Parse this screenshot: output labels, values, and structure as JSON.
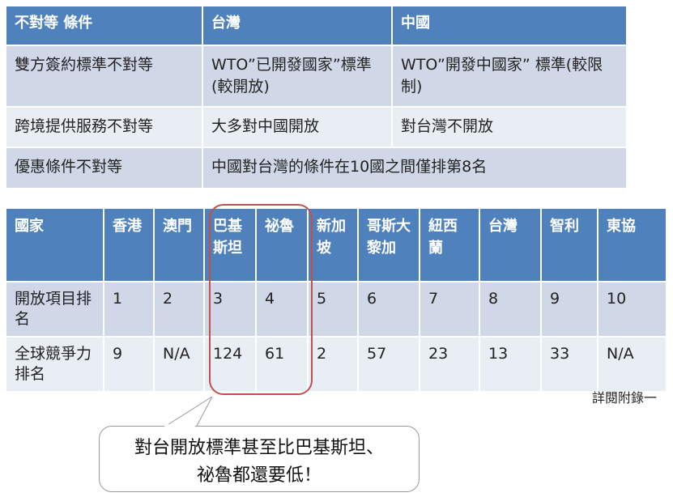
{
  "table1": {
    "headers": [
      "不對等 條件",
      "台灣",
      "中國"
    ],
    "rows": [
      [
        "雙方簽約標準不對等",
        "WTO”已開發國家”標準(較開放)",
        "WTO”開發中國家” 標準(較限制)"
      ],
      [
        "跨境提供服務不對等",
        "大多對中國開放",
        "對台灣不開放"
      ],
      [
        "優惠條件不對等",
        "中國對台灣的條件在10國之間僅排第8名"
      ]
    ]
  },
  "table2": {
    "headers": [
      "國家",
      "香港",
      "澳門",
      "巴基斯坦",
      "祕魯",
      "新加坡",
      "哥斯大黎加",
      "紐西蘭",
      "台灣",
      "智利",
      "東協"
    ],
    "rows": [
      [
        "開放項目排名",
        "1",
        "2",
        "3",
        "4",
        "5",
        "6",
        "7",
        "8",
        "9",
        "10"
      ],
      [
        "全球競爭力排名",
        "9",
        "N/A",
        "124",
        "61",
        "2",
        "57",
        "23",
        "13",
        "33",
        "N/A"
      ]
    ]
  },
  "note": "詳閱附錄一",
  "callout": {
    "line1": "對台開放標準甚至比巴基斯坦、",
    "line2": "祕魯都還要低！"
  },
  "colors": {
    "header": "#4f81bd",
    "row_dark": "#d0d8e8",
    "row_light": "#e9edf4",
    "highlight": "#c0504d"
  }
}
